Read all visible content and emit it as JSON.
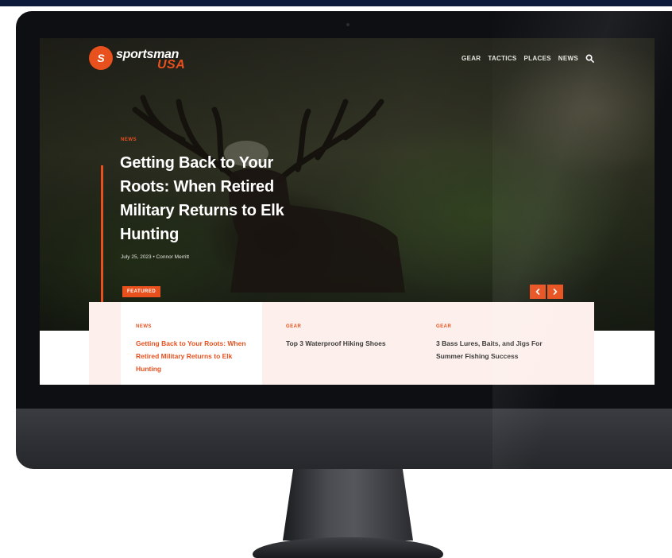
{
  "site": {
    "logo_mark": "S",
    "logo_text": "sportsman",
    "logo_subtext": "USA"
  },
  "nav": {
    "items": [
      "GEAR",
      "TACTICS",
      "PLACES",
      "NEWS"
    ],
    "search_icon": "search-icon"
  },
  "hero": {
    "category": "NEWS",
    "title": "Getting Back to Your Roots: When Retired Military Returns to Elk Hunting",
    "meta": "July 25, 2023  •  Connor Merritt"
  },
  "featured": {
    "label": "FEATURED",
    "prev_icon": "chevron-left-icon",
    "next_icon": "chevron-right-icon"
  },
  "cards": [
    {
      "category": "NEWS",
      "title": "Getting Back to Your Roots: When Retired Military Returns to Elk Hunting",
      "active": true
    },
    {
      "category": "GEAR",
      "title": "Top 3 Waterproof Hiking Shoes",
      "active": false
    },
    {
      "category": "GEAR",
      "title": "3 Bass Lures, Baits, and Jigs For Summer Fishing Success",
      "active": false
    }
  ],
  "colors": {
    "accent": "#e8501e",
    "card_bg": "#fdf0ec",
    "monitor": "#0e0f12"
  }
}
